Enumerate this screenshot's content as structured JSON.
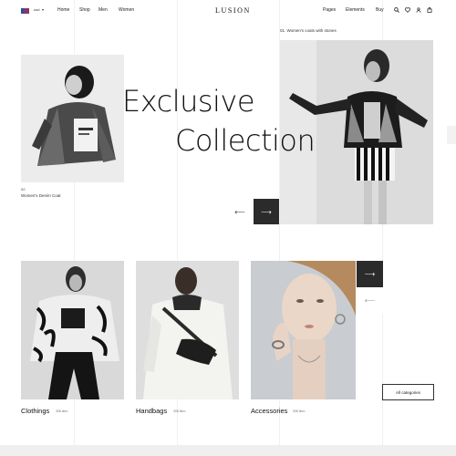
{
  "header": {
    "currency": "usd",
    "nav": [
      "Home",
      "Shop",
      "Men",
      "Women"
    ],
    "logo": "LUSION",
    "right_nav": [
      "Pages",
      "Elements",
      "Buy"
    ],
    "icons": [
      "search-icon",
      "heart-icon",
      "user-icon",
      "bag-icon"
    ]
  },
  "hero": {
    "title_line1": "Exclusive",
    "title_line2": "Collection",
    "item1": {
      "num": "02.",
      "label": "Women's Denim Coat"
    },
    "item2": {
      "label": "01. Women's coats with stones"
    }
  },
  "categories": [
    {
      "name": "Clothings",
      "count": "308 item"
    },
    {
      "name": "Handbags",
      "count": "308 item"
    },
    {
      "name": "Accessories",
      "count": "308 item"
    }
  ],
  "all_categories_label": "All categories",
  "colors": {
    "dark": "#2b2b2b",
    "text": "#111111"
  }
}
